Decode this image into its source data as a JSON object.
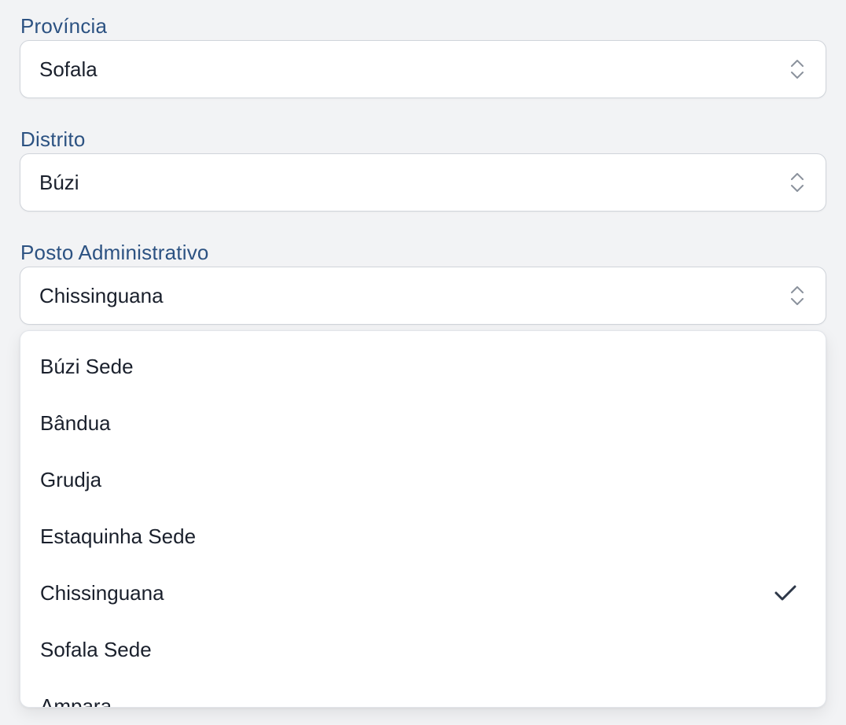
{
  "fields": {
    "provincia": {
      "label": "Província",
      "value": "Sofala"
    },
    "distrito": {
      "label": "Distrito",
      "value": "Búzi"
    },
    "posto": {
      "label": "Posto Administrativo",
      "value": "Chissinguana"
    }
  },
  "dropdown": {
    "options": [
      {
        "label": "Búzi Sede",
        "selected": false
      },
      {
        "label": "Bândua",
        "selected": false
      },
      {
        "label": "Grudja",
        "selected": false
      },
      {
        "label": "Estaquinha Sede",
        "selected": false
      },
      {
        "label": "Chissinguana",
        "selected": true
      },
      {
        "label": "Sofala Sede",
        "selected": false
      },
      {
        "label": "Ampara",
        "selected": false
      }
    ]
  },
  "icons": {
    "select_arrows": "chevron-up-down-icon",
    "selected_mark": "checkmark-icon"
  },
  "colors": {
    "label": "#2c5282",
    "text": "#1a202c",
    "check": "#2d3748",
    "background": "#f2f3f5"
  }
}
